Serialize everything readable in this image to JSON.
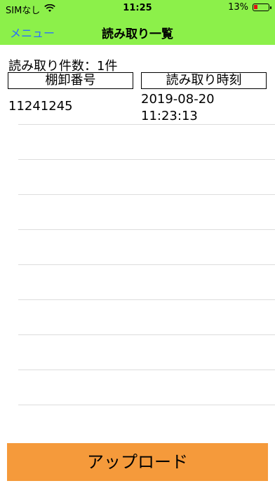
{
  "status_bar": {
    "carrier": "SIMなし",
    "time": "11:25",
    "battery_percent": "13%",
    "battery_level": 0.13,
    "wifi_icon": "wifi-icon",
    "battery_icon": "battery-icon"
  },
  "nav": {
    "back_label": "メニュー",
    "title": "読み取り一覧"
  },
  "summary": {
    "count_label": "読み取り件数：1件"
  },
  "columns": {
    "code_header": "棚卸番号",
    "time_header": "読み取り時刻"
  },
  "rows": [
    {
      "code": "11241245",
      "date": "2019-08-20",
      "time": "11:23:13"
    }
  ],
  "footer": {
    "upload_label": "アップロード"
  },
  "colors": {
    "topbar": "#8cf04a",
    "back_link": "#2b6fff",
    "upload_button": "#f59a3b",
    "battery_low": "#e11111"
  }
}
